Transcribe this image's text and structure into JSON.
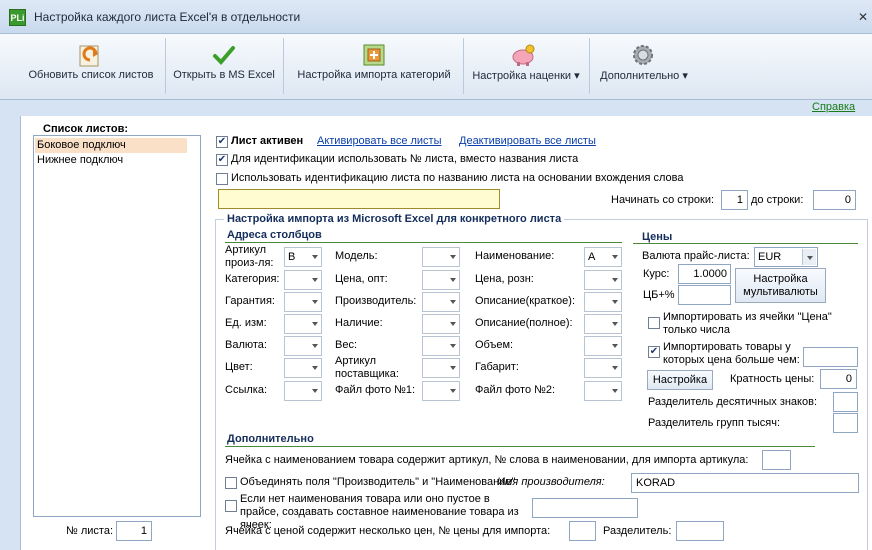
{
  "app": {
    "icon_text": "PLi",
    "title": "Настройка каждого листа Excel'я в отдельности",
    "close_icon": "close-icon"
  },
  "toolbar": {
    "refresh_label": "Обновить список листов",
    "open_excel_label": "Открыть в MS Excel",
    "category_import_label": "Настройка импорта категорий",
    "markup_label": "Настройка наценки",
    "more_label": "Дополнительно"
  },
  "help_link": "Справка",
  "sheets": {
    "label": "Список листов:",
    "items": [
      "Боковое подключ",
      "Нижнее подключ"
    ],
    "selected_index": 0,
    "num_label": "№ листа:",
    "num_value": "1"
  },
  "sheet_options": {
    "active_label": "Лист активен",
    "active_checked": true,
    "activate_all": "Активировать все листы",
    "deactivate_all": "Деактивировать все листы",
    "use_number_label": "Для идентификации использовать № листа, вместо названия листа",
    "use_number_checked": true,
    "use_name_label": "Использовать идентификацию листа по названию листа на основании вхождения слова",
    "use_name_checked": false,
    "word_value": "",
    "start_row_label": "Начинать со строки:",
    "start_row_value": "1",
    "end_row_label": "до строки:",
    "end_row_value": "0"
  },
  "import_group": {
    "title": "Настройка импорта из Microsoft Excel для конкретного листа",
    "columns_title": "Адреса столбцов",
    "col1": [
      {
        "label": "Артикул произ-ля:",
        "value": "B"
      },
      {
        "label": "Категория:",
        "value": ""
      },
      {
        "label": "Гарантия:",
        "value": ""
      },
      {
        "label": "Ед. изм:",
        "value": ""
      },
      {
        "label": "Валюта:",
        "value": ""
      },
      {
        "label": "Цвет:",
        "value": ""
      },
      {
        "label": "Ссылка:",
        "value": ""
      }
    ],
    "col2": [
      {
        "label": "Модель:",
        "value": ""
      },
      {
        "label": "Цена, опт:",
        "value": ""
      },
      {
        "label": "Производитель:",
        "value": ""
      },
      {
        "label": "Наличие:",
        "value": ""
      },
      {
        "label": "Вес:",
        "value": ""
      },
      {
        "label": "Артикул поставщика:",
        "value": ""
      },
      {
        "label": "Файл фото №1:",
        "value": ""
      }
    ],
    "col3": [
      {
        "label": "Наименование:",
        "value": "A"
      },
      {
        "label": "Цена, розн:",
        "value": ""
      },
      {
        "label": "Описание(краткое):",
        "value": ""
      },
      {
        "label": "Описание(полное):",
        "value": ""
      },
      {
        "label": "Объем:",
        "value": ""
      },
      {
        "label": "Габарит:",
        "value": ""
      },
      {
        "label": "Файл фото №2:",
        "value": ""
      }
    ]
  },
  "prices": {
    "title": "Цены",
    "currency_label": "Валюта прайс-листа:",
    "currency_value": "EUR",
    "rate_label": "Курс:",
    "rate_value": "1.0000",
    "cb_label": "ЦБ+%",
    "cb_value": "",
    "multi_currency_button": "Настройка мультивалюты",
    "import_from_price_cell_label": "Импортировать из ячейки \"Цена\" только числа",
    "import_from_price_cell_checked": false,
    "import_price_gt_label": "Импортировать товары у которых цена больше чем:",
    "import_price_gt_checked": true,
    "import_price_gt_value": "",
    "setup_button": "Настройка",
    "multiplicity_label": "Кратность цены:",
    "multiplicity_value": "0",
    "decimal_sep_label": "Разделитель десятичных знаков:",
    "decimal_sep_value": "",
    "thousands_sep_label": "Разделитель групп тысяч:",
    "thousands_sep_value": ""
  },
  "extra": {
    "title": "Дополнительно",
    "article_in_name_label": "Ячейка с наименованием товара содержит артикул, № слова в наименовании, для импорта артикула:",
    "article_in_name_value": "",
    "merge_fields_label": "Объединять поля \"Производитель\" и \"Наименование\"",
    "merge_fields_checked": false,
    "manufacturer_name_label": "Имя производителя:",
    "manufacturer_name_value": "KORAD",
    "composite_name_label": "Если нет наименования товара или оно пустое в прайсе, создавать составное наименование товара из ячеек:",
    "composite_name_checked": false,
    "composite_name_value": "",
    "multi_price_label": "Ячейка с ценой содержит несколько цен, № цены для импорта:",
    "multi_price_value": "",
    "separator_label": "Разделитель:",
    "separator_value": ""
  },
  "colors": {
    "accent": "#0b3ea8",
    "group_title": "#152e5c",
    "group_line": "#4a8a3a",
    "background": "#d6e3f2",
    "highlight": "#fffcd2"
  }
}
